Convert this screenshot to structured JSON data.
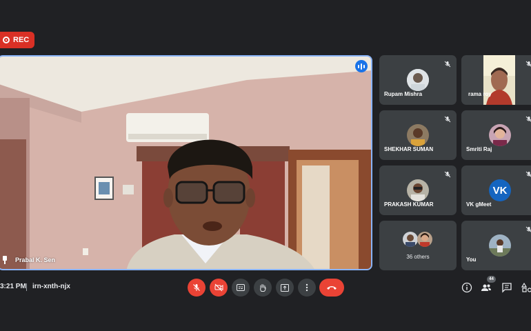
{
  "recording": {
    "label": "REC",
    "color": "#d93025"
  },
  "main_tile": {
    "name": "Prabal K. Sen",
    "speaking_icon": "audio-wave-icon",
    "pin_icon": "pin-icon"
  },
  "participants": [
    {
      "name": "Rupam Mishra",
      "muted": true,
      "avatar": "photo"
    },
    {
      "name": "rama roy",
      "muted": true,
      "avatar": "video"
    },
    {
      "name": "SHEKHAR SUMAN",
      "muted": true,
      "avatar": "photo"
    },
    {
      "name": "Smriti Raj",
      "muted": true,
      "avatar": "photo"
    },
    {
      "name": "PRAKASH KUMAR",
      "muted": true,
      "avatar": "photo"
    },
    {
      "name": "VK gMeet",
      "muted": true,
      "avatar": "initials",
      "initials": "VK",
      "color": "#1565c0"
    },
    {
      "name": "36 others",
      "muted": false,
      "avatar": "group"
    },
    {
      "name": "You",
      "muted": true,
      "avatar": "photo"
    }
  ],
  "footer": {
    "time": "3:21 PM",
    "meeting_code": "irn-xnth-njx",
    "controls": [
      "mic-off-icon",
      "camera-off-icon",
      "captions-icon",
      "raise-hand-icon",
      "present-icon",
      "more-options-icon",
      "end-call-icon"
    ],
    "right_icons": [
      "info-icon",
      "people-icon",
      "chat-icon",
      "activities-icon"
    ],
    "people_count": "44"
  },
  "colors": {
    "background": "#202124",
    "tile": "#3c4043",
    "active_border": "#8ab4f8",
    "danger": "#ea4335"
  }
}
